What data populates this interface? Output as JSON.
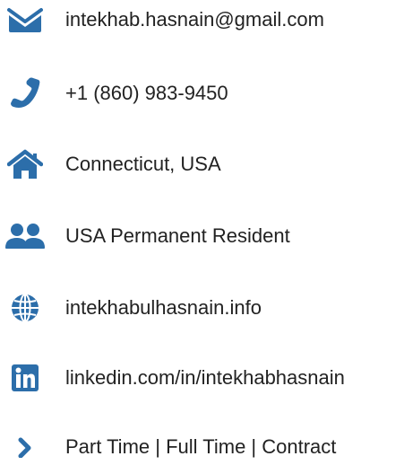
{
  "accent_color": "#2c6eaa",
  "contacts": [
    {
      "icon": "envelope-icon",
      "text": "intekhab.hasnain@gmail.com"
    },
    {
      "icon": "phone-icon",
      "text": "+1 (860) 983-9450"
    },
    {
      "icon": "home-icon",
      "text": "Connecticut, USA"
    },
    {
      "icon": "users-icon",
      "text": "USA Permanent Resident"
    },
    {
      "icon": "globe-icon",
      "text": "intekhabulhasnain.info"
    },
    {
      "icon": "linkedin-icon",
      "text": "linkedin.com/in/intekhabhasnain"
    },
    {
      "icon": "chevron-right-icon",
      "text": "Part Time | Full Time | Contract"
    }
  ]
}
